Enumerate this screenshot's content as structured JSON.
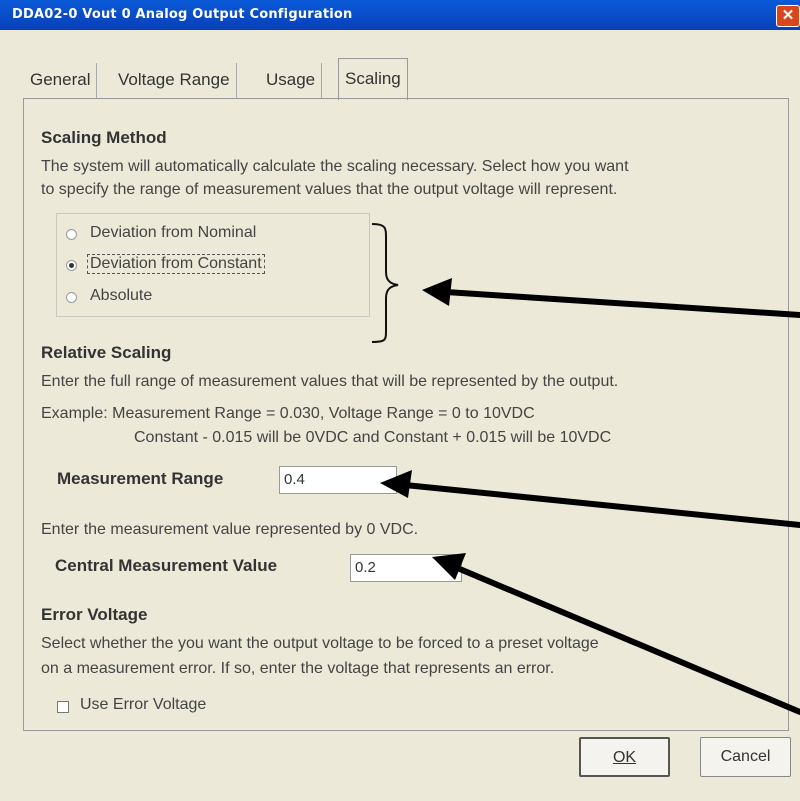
{
  "window": {
    "title": "DDA02-0 Vout 0 Analog Output Configuration",
    "close_glyph": "✕"
  },
  "tabs": [
    {
      "label": "General"
    },
    {
      "label": "Voltage Range"
    },
    {
      "label": "Usage"
    },
    {
      "label": "Scaling",
      "active": true
    }
  ],
  "scaling_method": {
    "heading": "Scaling Method",
    "description_line1": "The system will automatically calculate the scaling necessary.  Select how you want",
    "description_line2": "to specify the range of measurement values that the output voltage will represent.",
    "options": [
      {
        "label": "Deviation from Nominal",
        "selected": false
      },
      {
        "label": "Deviation from Constant",
        "selected": true
      },
      {
        "label": "Absolute",
        "selected": false
      }
    ]
  },
  "relative_scaling": {
    "heading": "Relative Scaling",
    "description": "Enter the full range of measurement values that will be represented by the output.",
    "example_line1": "Example:  Measurement Range = 0.030, Voltage Range = 0 to 10VDC",
    "example_line2": "Constant - 0.015 will be 0VDC and Constant + 0.015 will be 10VDC",
    "measurement_range_label": "Measurement Range",
    "measurement_range_value": "0.4",
    "central_prompt": "Enter the measurement value represented by 0 VDC.",
    "central_value_label": "Central Measurement Value",
    "central_value": "0.2"
  },
  "error_voltage": {
    "heading": "Error Voltage",
    "description_line1": "Select whether the you want the output voltage to be forced to a preset voltage",
    "description_line2": "on a measurement error.  If so, enter the voltage that represents an error.",
    "checkbox_label": "Use Error Voltage",
    "checked": false
  },
  "buttons": {
    "ok": "OK",
    "cancel": "Cancel"
  },
  "colors": {
    "titlebar": "#0a5ad8",
    "dialog_bg": "#ece9d8",
    "close": "#d9461e"
  }
}
